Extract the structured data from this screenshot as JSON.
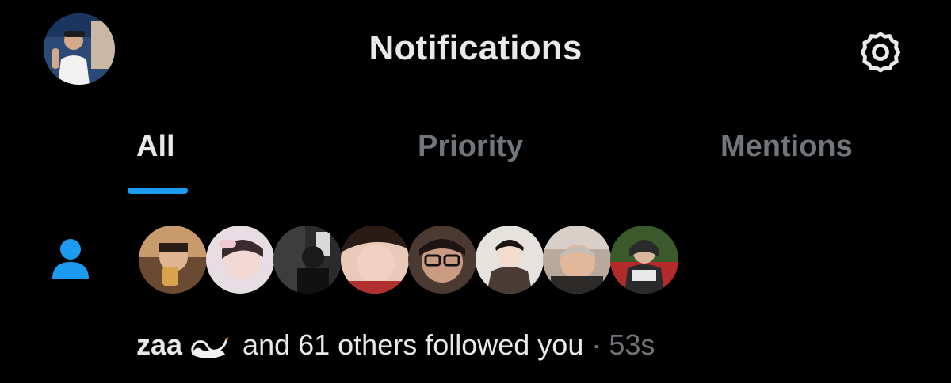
{
  "header": {
    "title": "Notifications",
    "profile_avatar": "profile-avatar",
    "settings_icon": "gear-icon"
  },
  "tabs": [
    {
      "label": "All",
      "active": true
    },
    {
      "label": "Priority",
      "active": false
    },
    {
      "label": "Mentions",
      "active": false
    }
  ],
  "notification": {
    "icon": "person-icon",
    "actor": "zaa",
    "actor_emoji": "🦢",
    "action_text": " and 61 others followed you",
    "separator": " · ",
    "time": "53s",
    "avatar_count": 8
  },
  "colors": {
    "accent": "#1d9bf0",
    "background": "#000000",
    "text_primary": "#e7e9ea",
    "text_secondary": "#71767b",
    "divider": "#2f3336"
  }
}
